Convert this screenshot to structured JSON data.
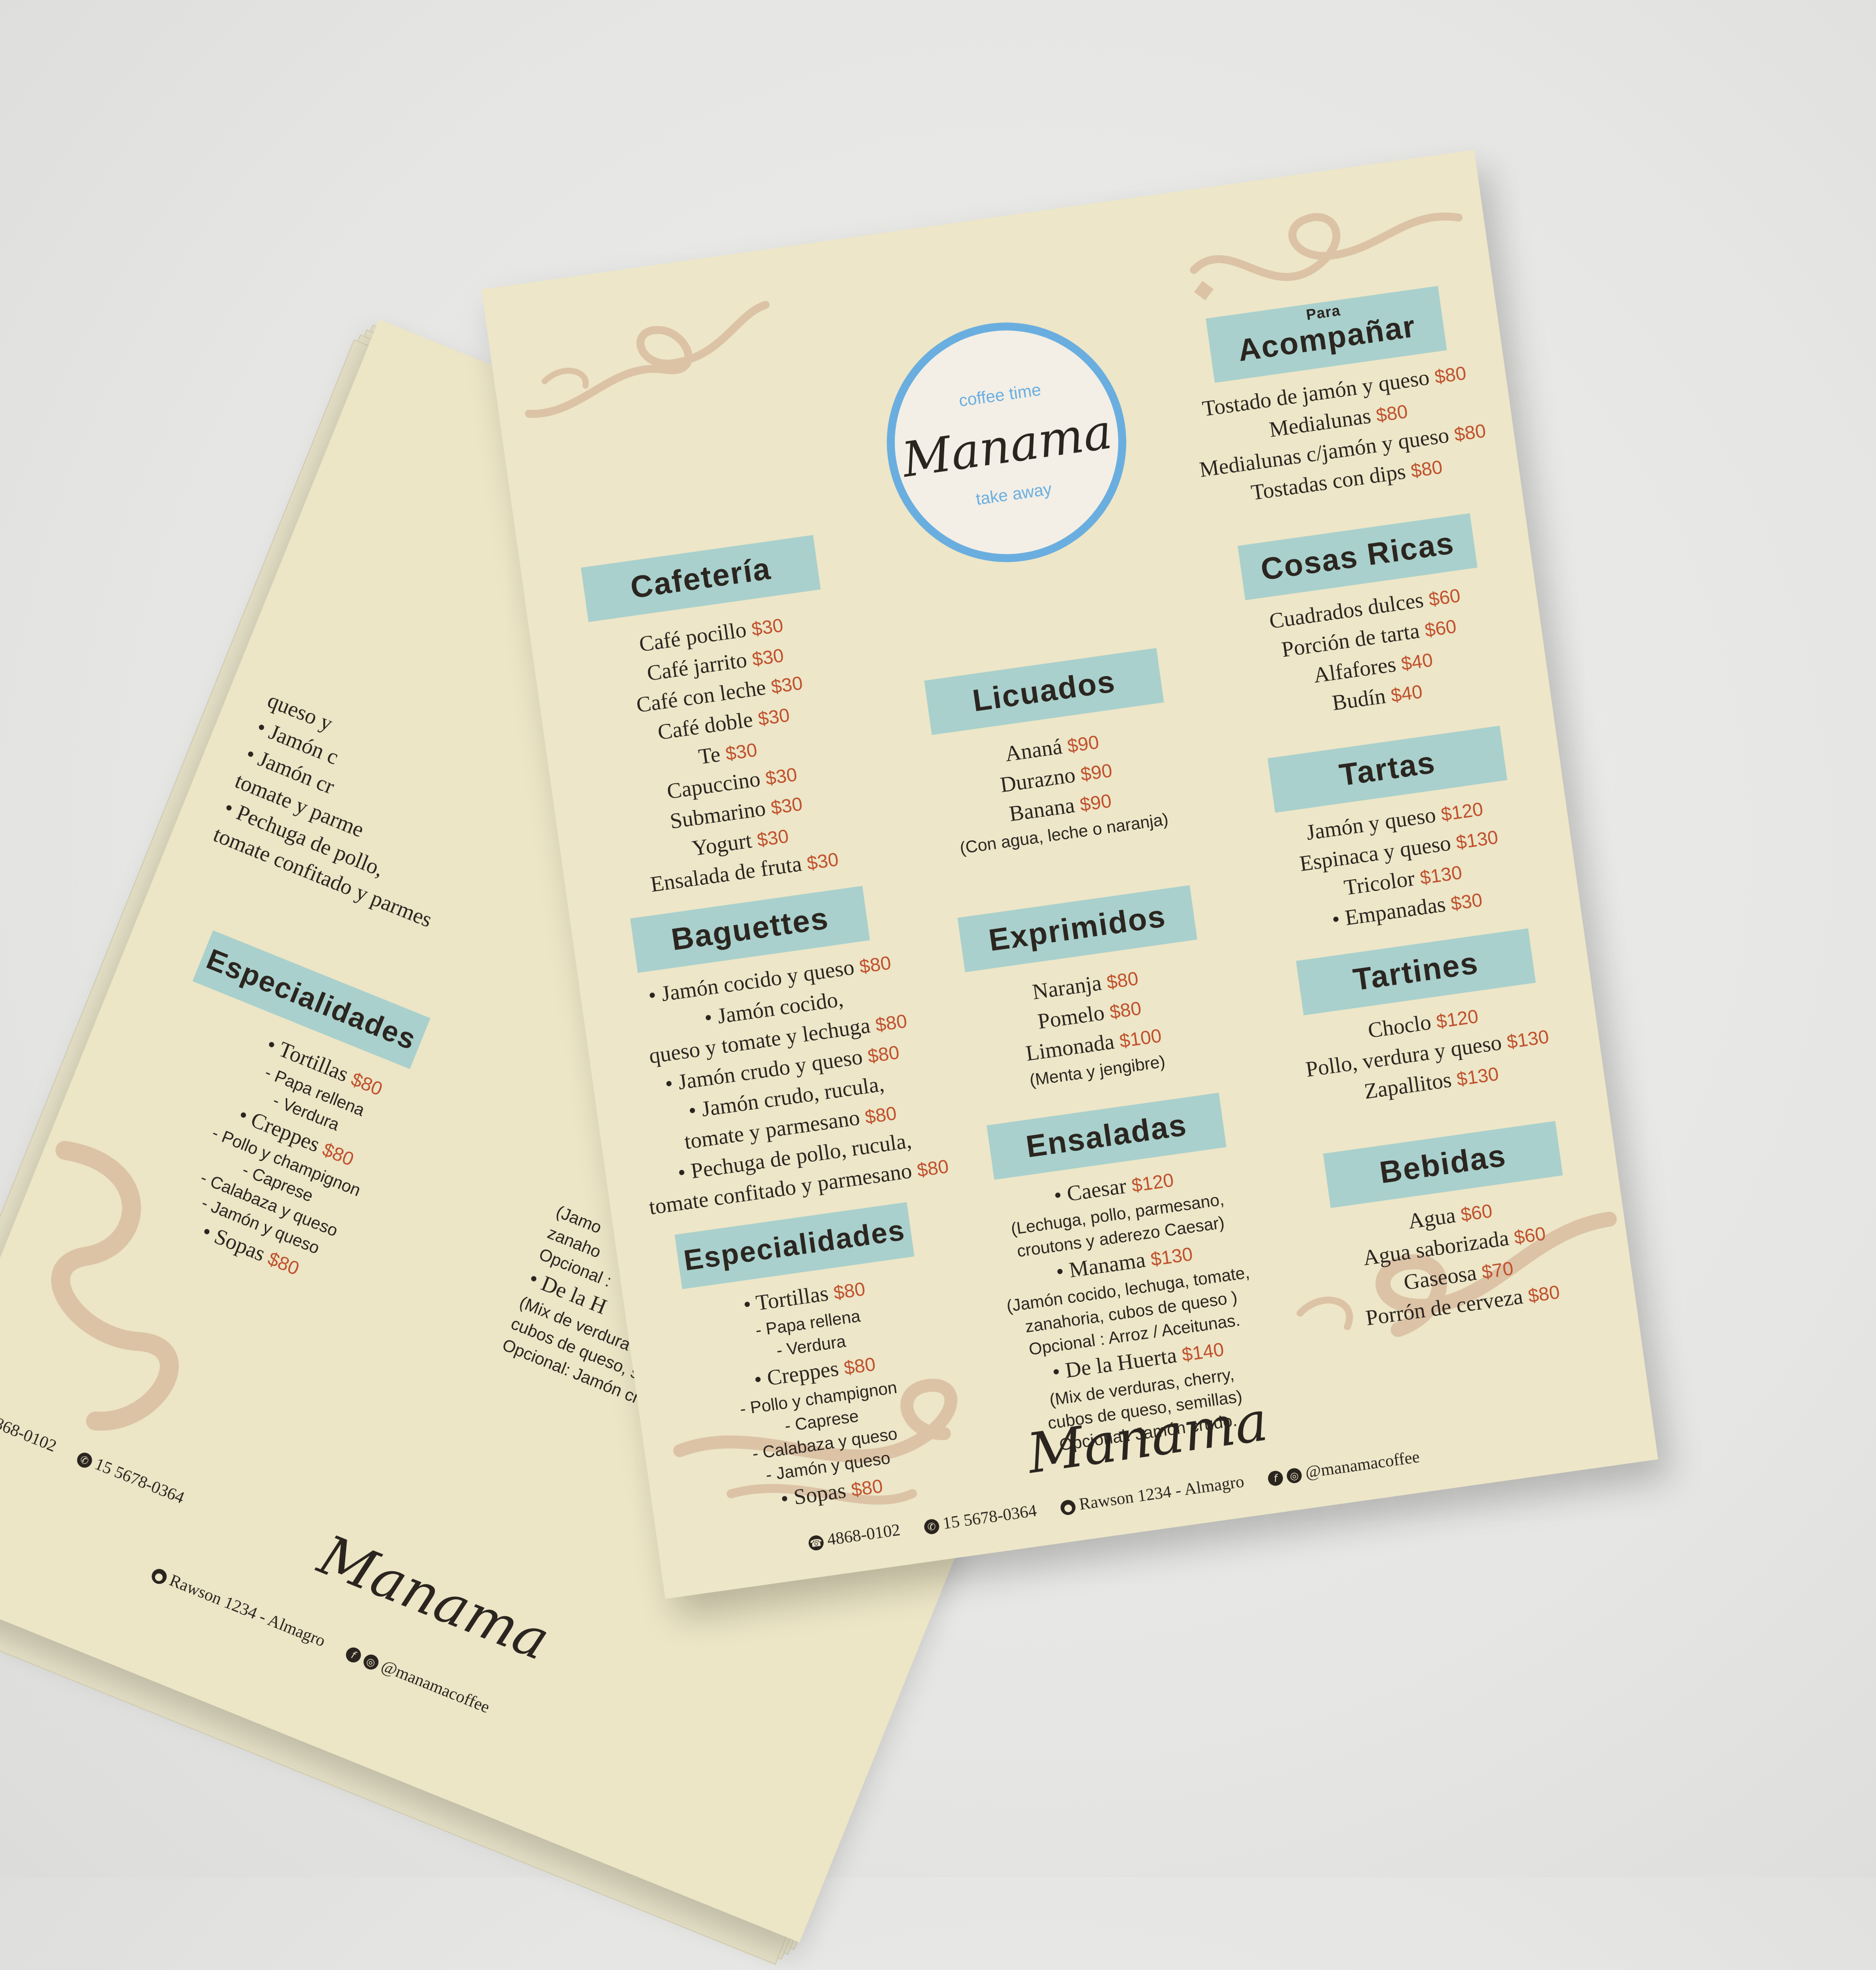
{
  "brand": {
    "name": "Manama",
    "tagline_top": "coffee time",
    "tagline_bottom": "take away"
  },
  "colors": {
    "paper": "#ede6c8",
    "header_bg": "#a9d0cc",
    "text": "#2b2520",
    "price": "#c0502c",
    "logo_ring": "#6aaee0",
    "ornament": "#dcc3a6"
  },
  "sections": {
    "cafeteria": {
      "title": "Cafetería",
      "items": [
        {
          "name": "Café pocillo",
          "price": "$30"
        },
        {
          "name": "Café jarrito",
          "price": "$30"
        },
        {
          "name": "Café con leche",
          "price": "$30"
        },
        {
          "name": "Café doble",
          "price": "$30"
        },
        {
          "name": "Te",
          "price": "$30"
        },
        {
          "name": "Capuccino",
          "price": "$30"
        },
        {
          "name": "Submarino",
          "price": "$30"
        },
        {
          "name": "Yogurt",
          "price": "$30"
        },
        {
          "name": "Ensalada de fruta",
          "price": "$30"
        }
      ]
    },
    "baguettes": {
      "title": "Baguettes",
      "items": [
        {
          "name": "• Jamón cocido y queso",
          "price": "$80"
        },
        {
          "name": "• Jamón cocido,",
          "price": ""
        },
        {
          "name": "queso y tomate y lechuga",
          "price": "$80"
        },
        {
          "name": "• Jamón crudo y queso",
          "price": "$80"
        },
        {
          "name": "• Jamón crudo, rucula,",
          "price": ""
        },
        {
          "name": "tomate y parmesano",
          "price": "$80"
        },
        {
          "name": "• Pechuga de pollo, rucula,",
          "price": ""
        },
        {
          "name": "tomate confitado y parmesano",
          "price": "$80"
        }
      ]
    },
    "especialidades": {
      "title": "Especialidades",
      "items": [
        {
          "name": "• Tortillas",
          "price": "$80",
          "small": false
        },
        {
          "name": "- Papa rellena",
          "price": "",
          "small": true
        },
        {
          "name": "- Verdura",
          "price": "",
          "small": true
        },
        {
          "name": "• Creppes",
          "price": "$80",
          "small": false
        },
        {
          "name": "- Pollo y champignon",
          "price": "",
          "small": true
        },
        {
          "name": "- Caprese",
          "price": "",
          "small": true
        },
        {
          "name": "- Calabaza y queso",
          "price": "",
          "small": true
        },
        {
          "name": "- Jamón y queso",
          "price": "",
          "small": true
        },
        {
          "name": "• Sopas",
          "price": "$80",
          "small": false
        }
      ]
    },
    "licuados": {
      "title": "Licuados",
      "items": [
        {
          "name": "Ananá",
          "price": "$90"
        },
        {
          "name": "Durazno",
          "price": "$90"
        },
        {
          "name": "Banana",
          "price": "$90"
        }
      ],
      "note": "(Con agua, leche o naranja)"
    },
    "exprimidos": {
      "title": "Exprimidos",
      "items": [
        {
          "name": "Naranja",
          "price": "$80"
        },
        {
          "name": "Pomelo",
          "price": "$80"
        },
        {
          "name": "Limonada",
          "price": "$100"
        }
      ],
      "note": "(Menta y jengibre)"
    },
    "ensaladas": {
      "title": "Ensaladas",
      "items": [
        {
          "name": "• Caesar",
          "price": "$120",
          "small": false
        },
        {
          "name": "(Lechuga, pollo, parmesano,",
          "price": "",
          "small": true
        },
        {
          "name": "croutons y aderezo Caesar)",
          "price": "",
          "small": true
        },
        {
          "name": "• Manama",
          "price": "$130",
          "small": false
        },
        {
          "name": "(Jamón cocido, lechuga, tomate,",
          "price": "",
          "small": true
        },
        {
          "name": "zanahoria, cubos de queso )",
          "price": "",
          "small": true
        },
        {
          "name": "Opcional : Arroz / Aceitunas.",
          "price": "",
          "small": true
        },
        {
          "name": "• De la Huerta",
          "price": "$140",
          "small": false
        },
        {
          "name": "(Mix de verduras, cherry,",
          "price": "",
          "small": true
        },
        {
          "name": "cubos de queso, semillas)",
          "price": "",
          "small": true
        },
        {
          "name": "Opcional: Jamón crudo.",
          "price": "",
          "small": true
        }
      ]
    },
    "acompanar": {
      "title_small": "Para",
      "title": "Acompañar",
      "items": [
        {
          "name": "Tostado de jamón y queso",
          "price": "$80"
        },
        {
          "name": "Medialunas",
          "price": "$80"
        },
        {
          "name": "Medialunas c/jamón y queso",
          "price": "$80"
        },
        {
          "name": "Tostadas con dips",
          "price": "$80"
        }
      ]
    },
    "cosas_ricas": {
      "title": "Cosas Ricas",
      "items": [
        {
          "name": "Cuadrados dulces",
          "price": "$60"
        },
        {
          "name": "Porción de tarta",
          "price": "$60"
        },
        {
          "name": "Alfafores",
          "price": "$40"
        },
        {
          "name": "Budín",
          "price": "$40"
        }
      ]
    },
    "tartas": {
      "title": "Tartas",
      "items": [
        {
          "name": "Jamón y queso",
          "price": "$120"
        },
        {
          "name": "Espinaca y queso",
          "price": "$130"
        },
        {
          "name": "Tricolor",
          "price": "$130"
        },
        {
          "name": "• Empanadas",
          "price": "$30"
        }
      ]
    },
    "tartines": {
      "title": "Tartines",
      "items": [
        {
          "name": "Choclo",
          "price": "$120"
        },
        {
          "name": "Pollo, verdura y queso",
          "price": "$130"
        },
        {
          "name": "Zapallitos",
          "price": "$130"
        }
      ]
    },
    "bebidas": {
      "title": "Bebidas",
      "items": [
        {
          "name": "Agua",
          "price": "$60"
        },
        {
          "name": "Agua saborizada",
          "price": "$60"
        },
        {
          "name": "Gaseosa",
          "price": "$70"
        },
        {
          "name": "Porrón de cerveza",
          "price": "$80"
        }
      ]
    }
  },
  "back_sheet": {
    "fragments": [
      "queso y",
      "• Jamón c",
      "• Jamón cr",
      "tomate y parme",
      "• Pechuga de pollo,",
      "tomate confitado y parmes"
    ],
    "right_fragments": [
      "(Jamo",
      "zanaho",
      "Opcional :",
      "• De la H",
      "(Mix de verdura",
      "cubos de queso, s",
      "Opcional: Jamón cru"
    ]
  },
  "contact": {
    "phone": "4868-0102",
    "whatsapp": "15 5678-0364",
    "address": "Rawson 1234 - Almagro",
    "social": "@manamacoffee"
  },
  "icons": {
    "phone": "phone-icon",
    "whatsapp": "whatsapp-icon",
    "location": "location-pin-icon",
    "facebook": "facebook-icon",
    "instagram": "instagram-icon"
  }
}
